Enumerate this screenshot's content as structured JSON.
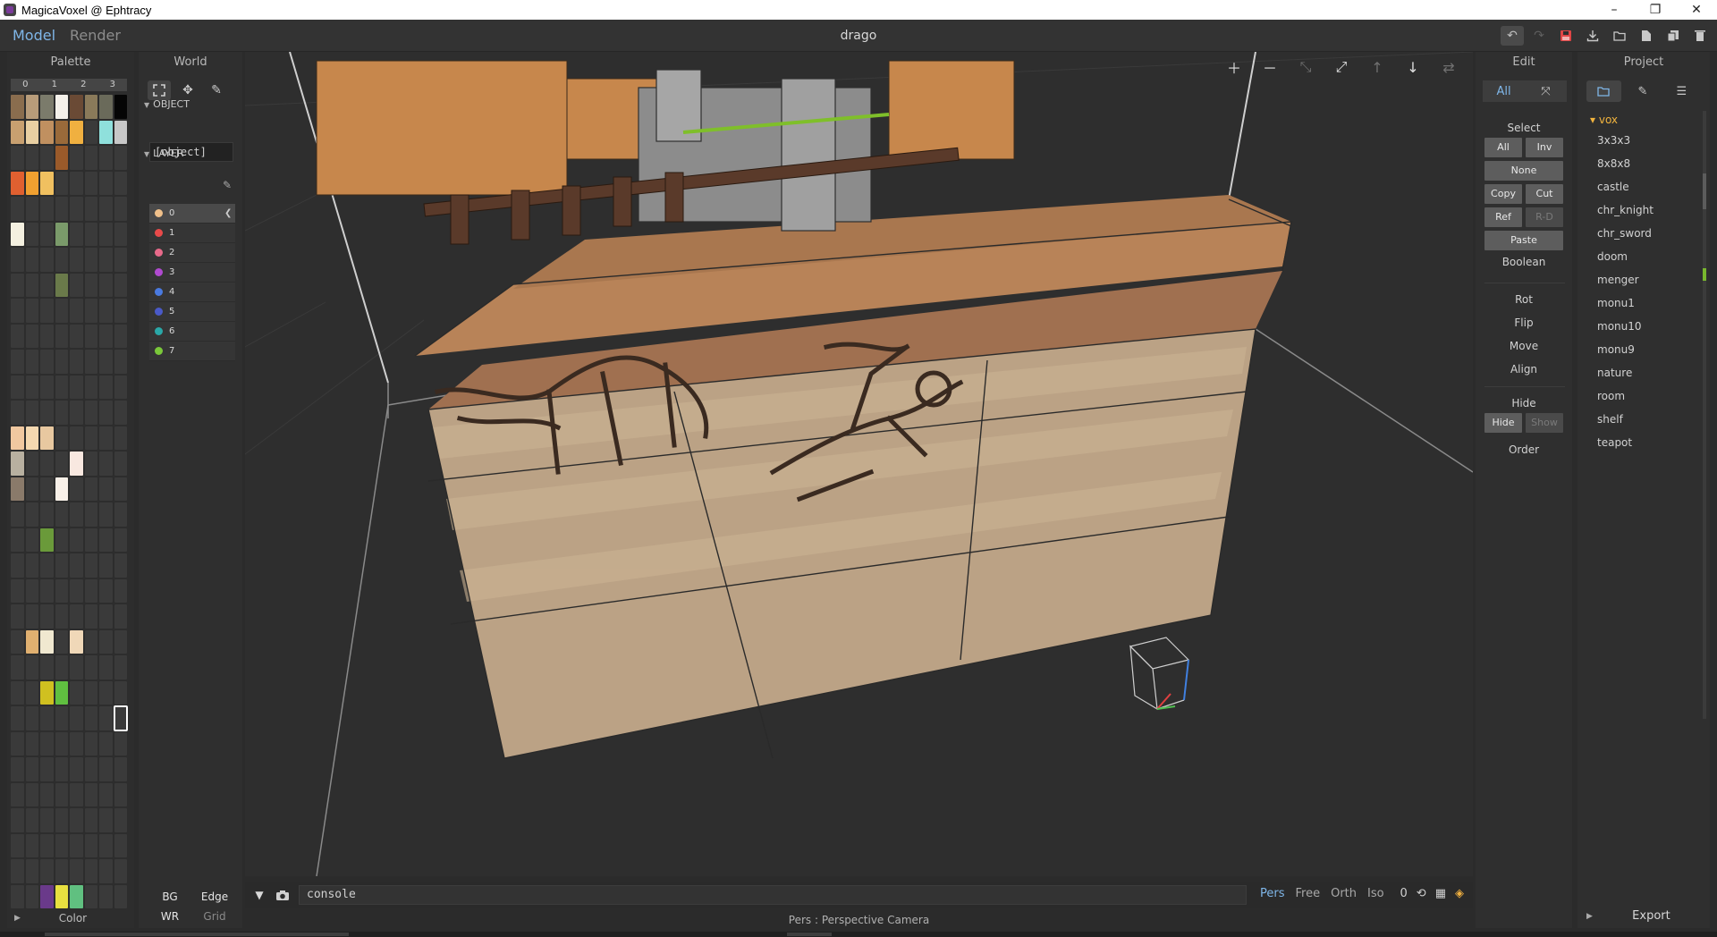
{
  "window": {
    "title": "MagicaVoxel @ Ephtracy",
    "controls": [
      "–",
      "❐",
      "✕"
    ]
  },
  "topbar": {
    "modes": [
      "Model",
      "Render"
    ],
    "active_mode": "Model",
    "document": "drago",
    "tools": [
      "undo",
      "redo",
      "save",
      "export",
      "open",
      "new",
      "duplicate",
      "delete"
    ]
  },
  "palette": {
    "title": "Palette",
    "columns": [
      "0",
      "1",
      "2",
      "3"
    ],
    "footer": "Color",
    "colors": {
      "0": "#8a6d4e",
      "1": "#b89c7a",
      "2": "#7b7b6b",
      "3": "#f4f1ea",
      "4": "#6a4a35",
      "5": "#8a7a5a",
      "6": "#6a6a5a",
      "7": "#050505",
      "8": "#c8a070",
      "9": "#e8cfa2",
      "10": "#c09060",
      "11": "#9a6a3a",
      "12": "#f0b040",
      "13": "#3a3a3a",
      "14": "#8fe0dc",
      "15": "#c7c7c7",
      "19": "#9a5a2a",
      "24": "#e06030",
      "25": "#f0a030",
      "26": "#f0c060",
      "40": "#f4f0e0",
      "43": "#7a9a6a",
      "59": "#6a7a4a",
      "104": "#f0c8a0",
      "105": "#f4d8b0",
      "106": "#e8c8a0",
      "112": "#b8b0a0",
      "116": "#f8e8e0",
      "120": "#8a7a6a",
      "123": "#f8f0e8",
      "138": "#6a9a3a",
      "169": "#e0b070",
      "170": "#f0e8d0",
      "172": "#f0d8b8",
      "186": "#d0c020",
      "187": "#60c040",
      "250": "#6a3a8a",
      "251": "#e8e040",
      "252": "#60c080"
    },
    "selected_index": 199
  },
  "world": {
    "title": "World",
    "object_section": "OBJECT",
    "object_value": "[object]",
    "layer_section": "LAYER",
    "layers": [
      {
        "name": "0",
        "color": "#f0c08a"
      },
      {
        "name": "1",
        "color": "#e84a4a"
      },
      {
        "name": "2",
        "color": "#e86a8a"
      },
      {
        "name": "3",
        "color": "#b04ad0"
      },
      {
        "name": "4",
        "color": "#4a7ae0"
      },
      {
        "name": "5",
        "color": "#4a5ac8"
      },
      {
        "name": "6",
        "color": "#2aa8a8"
      },
      {
        "name": "7",
        "color": "#7ac83a"
      }
    ],
    "footer": {
      "bg": "BG",
      "edge": "Edge",
      "wr": "WR",
      "grid": "Grid"
    }
  },
  "viewport": {
    "console_placeholder": "console",
    "camera_modes": [
      "Pers",
      "Free",
      "Orth",
      "Iso"
    ],
    "active_camera": "Pers",
    "zoom_value": "0",
    "status": "Pers : Perspective Camera"
  },
  "edit": {
    "title": "Edit",
    "all_label": "All",
    "select_label": "Select",
    "buttons": {
      "all": "All",
      "inv": "Inv",
      "none": "None",
      "copy": "Copy",
      "cut": "Cut",
      "ref": "Ref",
      "rd": "R-D",
      "paste": "Paste",
      "boolean": "Boolean",
      "rot": "Rot",
      "flip": "Flip",
      "move": "Move",
      "align": "Align",
      "hide_label": "Hide",
      "hide": "Hide",
      "show": "Show",
      "order": "Order"
    }
  },
  "project": {
    "title": "Project",
    "folder": "vox",
    "files": [
      "3x3x3",
      "8x8x8",
      "castle",
      "chr_knight",
      "chr_sword",
      "doom",
      "menger",
      "monu1",
      "monu10",
      "monu9",
      "nature",
      "room",
      "shelf",
      "teapot"
    ],
    "footer": "Export"
  }
}
